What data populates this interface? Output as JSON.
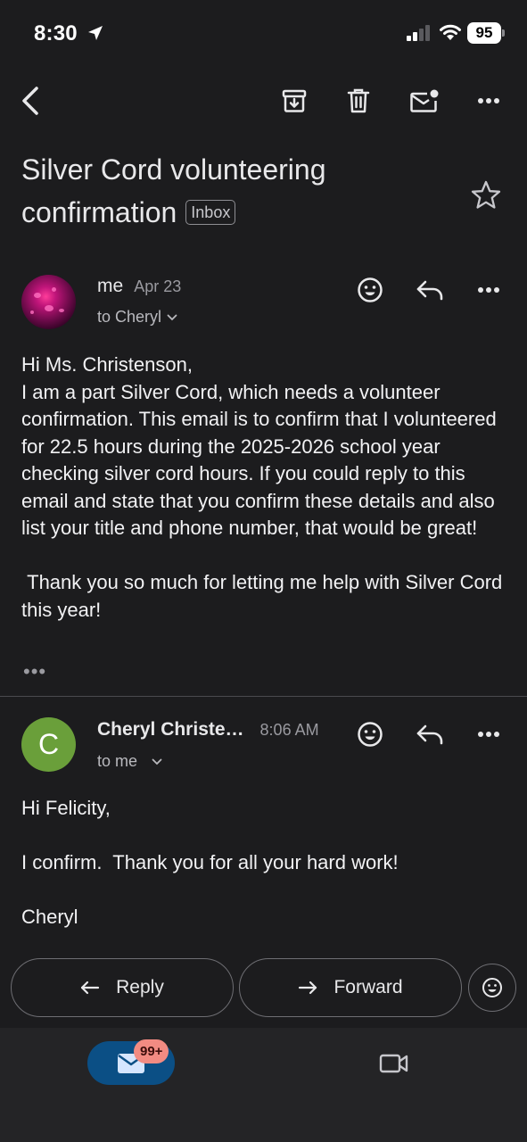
{
  "status_bar": {
    "time": "8:30",
    "battery": "95"
  },
  "toolbar": {
    "icons": [
      "back-arrow-icon",
      "archive-icon",
      "trash-icon",
      "mark-unread-icon",
      "more-icon"
    ]
  },
  "subject": {
    "title": "Silver Cord volunteering confirmation",
    "label": "Inbox"
  },
  "messages": [
    {
      "sender": "me",
      "date": "Apr 23",
      "recipient": "to Cheryl",
      "body": "Hi Ms. Christenson,\nI am a part Silver Cord, which needs a volunteer confirmation. This email is to confirm that I volunteered for 22.5 hours during the 2025-2026 school year checking silver cord hours. If you could reply to this email and state that you confirm these details and also list your title and phone number, that would be great!\n\n Thank you so much for letting me help with Silver Cord this year!",
      "trimmed_indicator": "•••"
    },
    {
      "sender": "Cheryl Christe…",
      "avatar_letter": "C",
      "date": "8:06 AM",
      "recipient": "to me",
      "body": "Hi Felicity,\n\nI confirm.  Thank you for all your hard work!\n\nCheryl"
    }
  ],
  "actions": {
    "reply": "Reply",
    "forward": "Forward"
  },
  "bottom_nav": {
    "mail_badge": "99+"
  },
  "colors": {
    "background": "#1c1c1e",
    "avatar_green": "#6a9f3a",
    "mail_tab": "#0b4f85",
    "badge": "#f28b82"
  }
}
